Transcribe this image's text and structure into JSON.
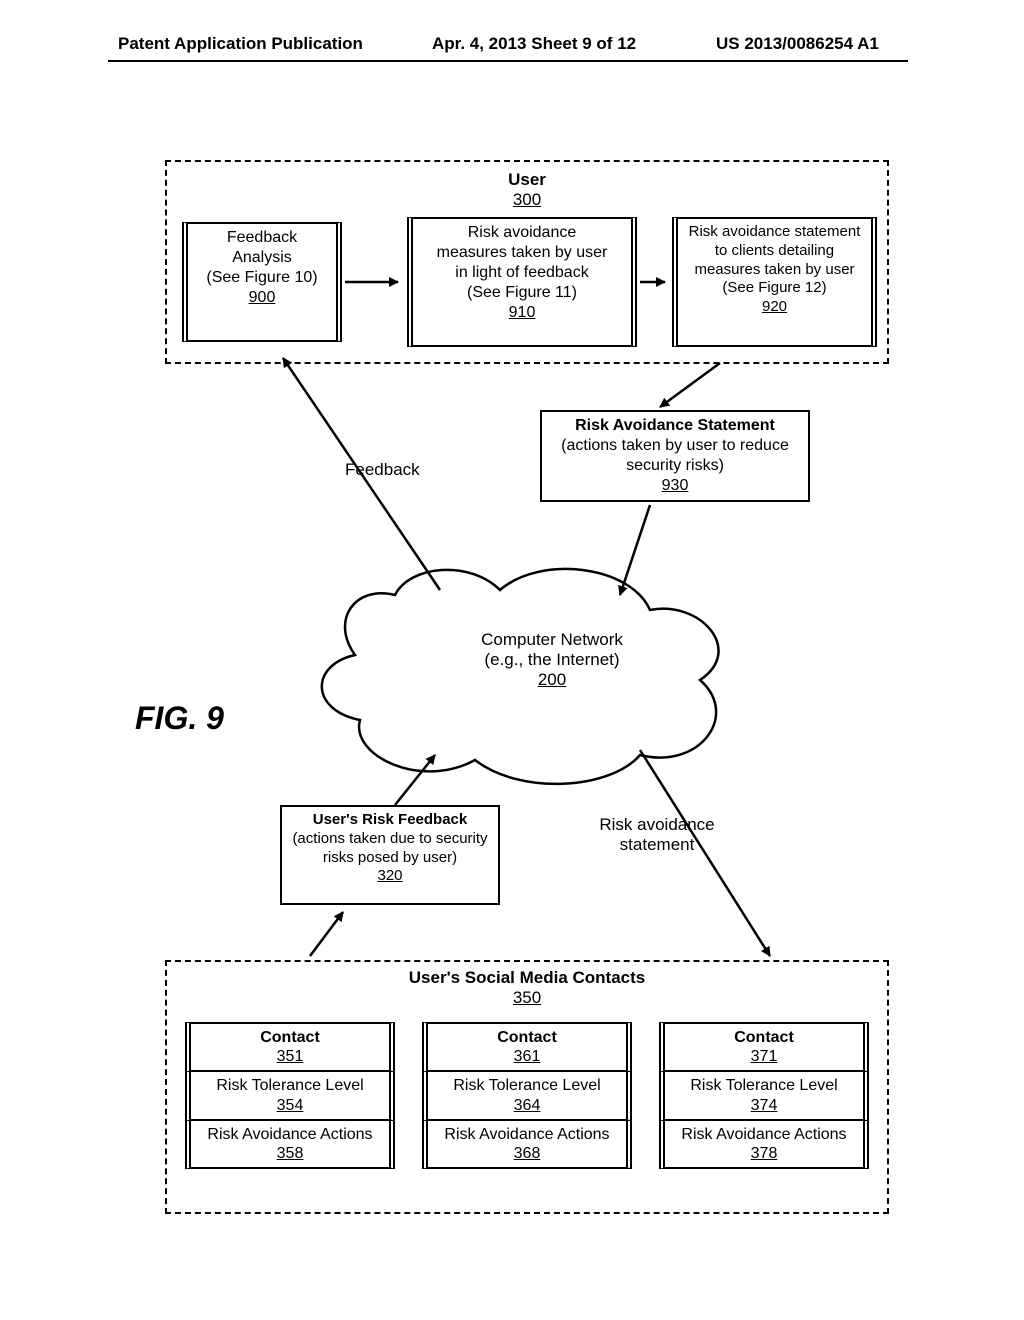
{
  "header": {
    "left": "Patent Application Publication",
    "mid": "Apr. 4, 2013   Sheet 9 of 12",
    "right": "US 2013/0086254 A1"
  },
  "figure_label": "FIG. 9",
  "user_panel": {
    "title": "User",
    "ref": "300",
    "feedback_analysis": {
      "l1": "Feedback",
      "l2": "Analysis",
      "l3": "(See Figure 10)",
      "ref": "900"
    },
    "risk_measures": {
      "l1": "Risk avoidance",
      "l2": "measures taken by user",
      "l3": "in light of feedback",
      "l4": "(See Figure 11)",
      "ref": "910"
    },
    "risk_statement": {
      "l1": "Risk avoidance statement",
      "l2": "to clients detailing",
      "l3": "measures taken by user",
      "l4": "(See Figure 12)",
      "ref": "920"
    }
  },
  "ras_box": {
    "title": "Risk Avoidance Statement",
    "desc": "(actions taken by user to reduce security risks)",
    "ref": "930"
  },
  "feedback_label": "Feedback",
  "cloud": {
    "l1": "Computer Network",
    "l2": "(e.g., the Internet)",
    "ref": "200"
  },
  "urf_box": {
    "title": "User's Risk Feedback",
    "desc": "(actions taken due to security risks posed by user)",
    "ref": "320"
  },
  "ras_label": "Risk avoidance statement",
  "contacts_panel": {
    "title": "User's Social Media Contacts",
    "ref": "350",
    "cols": [
      {
        "contact": "Contact",
        "cref": "351",
        "rtl": "Risk Tolerance Level",
        "rtlref": "354",
        "raa": "Risk Avoidance Actions",
        "raaref": "358"
      },
      {
        "contact": "Contact",
        "cref": "361",
        "rtl": "Risk Tolerance Level",
        "rtlref": "364",
        "raa": "Risk Avoidance Actions",
        "raaref": "368"
      },
      {
        "contact": "Contact",
        "cref": "371",
        "rtl": "Risk Tolerance Level",
        "rtlref": "374",
        "raa": "Risk Avoidance Actions",
        "raaref": "378"
      }
    ]
  }
}
